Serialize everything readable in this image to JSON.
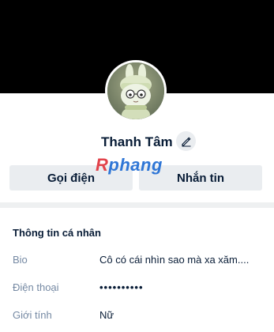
{
  "profile": {
    "name": "Thanh Tâm",
    "avatar_icon": "avatar-photo",
    "edit_icon": "pencil-icon"
  },
  "actions": {
    "call_label": "Gọi điện",
    "message_label": "Nhắn tin"
  },
  "watermark": {
    "first_letter": "R",
    "rest": "phang"
  },
  "info": {
    "section_title": "Thông tin cá nhân",
    "bio_label": "Bio",
    "bio_value": "Cô có cái nhìn sao mà xa xăm....",
    "phone_label": "Điện thoại",
    "phone_value": "••••••••••",
    "gender_label": "Giới tính",
    "gender_value": "Nữ"
  },
  "colors": {
    "cover": "#000000",
    "text_primary": "#081c36",
    "text_secondary": "#7589a3",
    "button_bg": "#eaedf0",
    "divider": "#eef0f1"
  }
}
